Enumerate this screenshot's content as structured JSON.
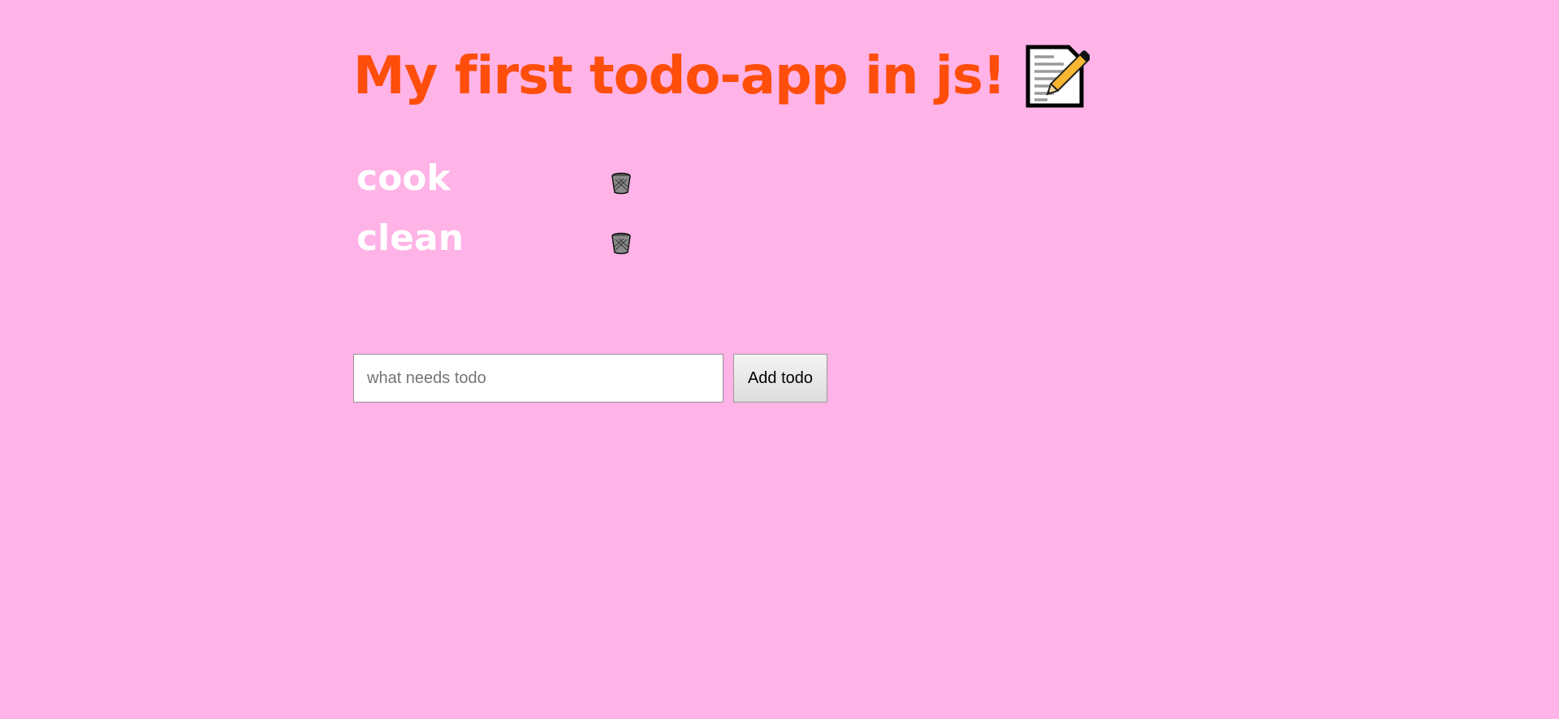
{
  "header": {
    "title": "My first todo-app in js!",
    "title_icon": "memo-icon",
    "title_color": "#ff4d0a"
  },
  "todos": [
    {
      "text": "cook",
      "delete_icon": "wastebasket-icon"
    },
    {
      "text": "clean",
      "delete_icon": "wastebasket-icon"
    }
  ],
  "form": {
    "input_placeholder": "what needs todo",
    "input_value": "",
    "add_button_label": "Add todo"
  },
  "colors": {
    "background": "#ffb3e6",
    "todo_text": "#ffffff"
  }
}
